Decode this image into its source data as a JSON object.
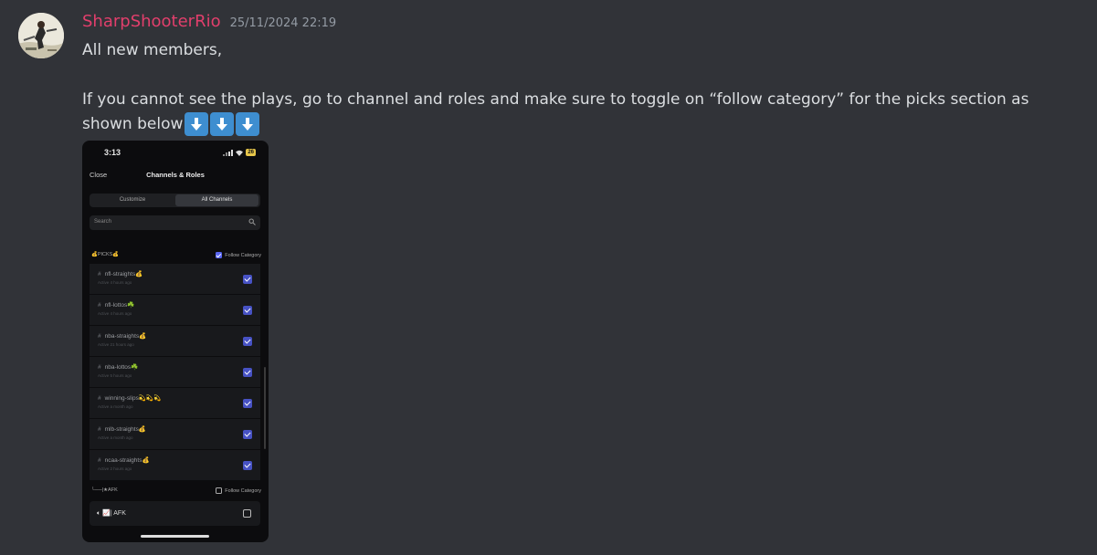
{
  "message": {
    "author": "SharpShooterRio",
    "timestamp": "25/11/2024 22:19",
    "author_color": "#e23f6c",
    "lines": [
      "All new members,",
      "If you cannot see the plays, go to channel and roles and make sure to toggle on “follow category” for the picks section as",
      "shown below"
    ],
    "emoji": [
      "arrow-down-emoji",
      "arrow-down-emoji",
      "arrow-down-emoji"
    ]
  },
  "phone": {
    "time": "3:13",
    "battery": "26",
    "close": "Close",
    "title": "Channels & Roles",
    "tabs": [
      "Customize",
      "All Channels"
    ],
    "search_placeholder": "Search",
    "picks_category": "💰PICKS💰",
    "follow_category": "Follow Category",
    "channels": [
      {
        "name": "nfl-straights💰",
        "activity": "Active 4 hours ago"
      },
      {
        "name": "nfl-lottos☘️",
        "activity": "Active 4 hours ago"
      },
      {
        "name": "nba-straights💰",
        "activity": "Active 21 hours ago"
      },
      {
        "name": "nba-lottos☘️",
        "activity": "Active 5 hours ago"
      },
      {
        "name": "winning-slips💫💫💫",
        "activity": "Active a month ago"
      },
      {
        "name": "mlb-straights💰",
        "activity": "Active a month ago"
      },
      {
        "name": "ncaa-straights💰",
        "activity": "Active 2 hours ago"
      }
    ],
    "afk_category": "└──|★AFK",
    "afk_channel": "📈| AFK"
  }
}
